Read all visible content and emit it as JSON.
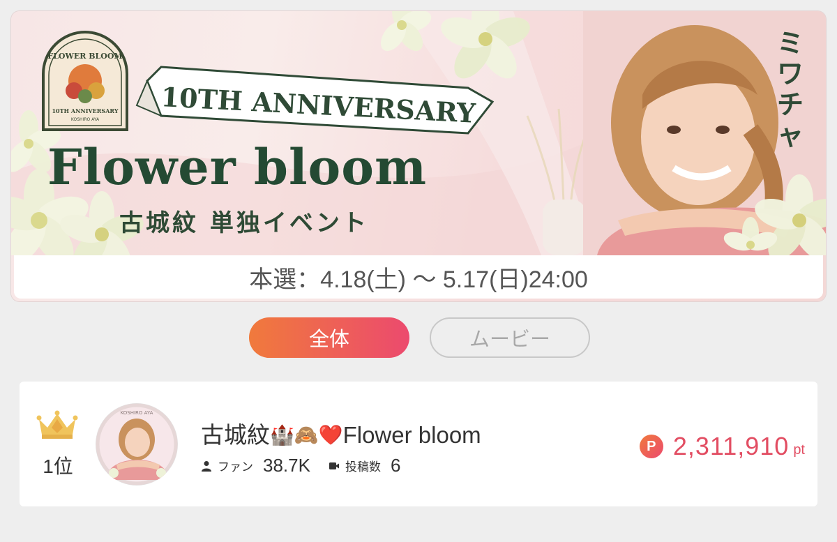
{
  "banner": {
    "badge_top": "FLOWER BLOOM",
    "badge_anniversary": "10TH ANNIVERSARY",
    "badge_name": "KOSHIRO AYA",
    "ribbon_text": "10TH ANNIVERSARY",
    "title": "Flower bloom",
    "subtitle": "古城紋 単独イベント",
    "brand_logo": "ミワチャ",
    "date_text": "本選：4.18(土) 〜 5.17(日)24:00"
  },
  "tabs": [
    {
      "label": "全体",
      "active": true
    },
    {
      "label": "ムービー",
      "active": false
    }
  ],
  "ranking": [
    {
      "rank_label": "1位",
      "user_name": "古城紋",
      "name_emojis": "🏰🙈❤️",
      "name_suffix": "Flower bloom",
      "fans_label": "ファン",
      "fans_value": "38.7K",
      "posts_label": "投稿数",
      "posts_value": "6",
      "points_badge": "P",
      "points_value": "2,311,910",
      "points_unit": "pt",
      "avatar_caption": "KOSHIRO AYA"
    }
  ],
  "colors": {
    "accent_gradient_start": "#f07a3c",
    "accent_gradient_end": "#ec4a6e",
    "points_color": "#e24d62",
    "title_green": "#244a33"
  }
}
